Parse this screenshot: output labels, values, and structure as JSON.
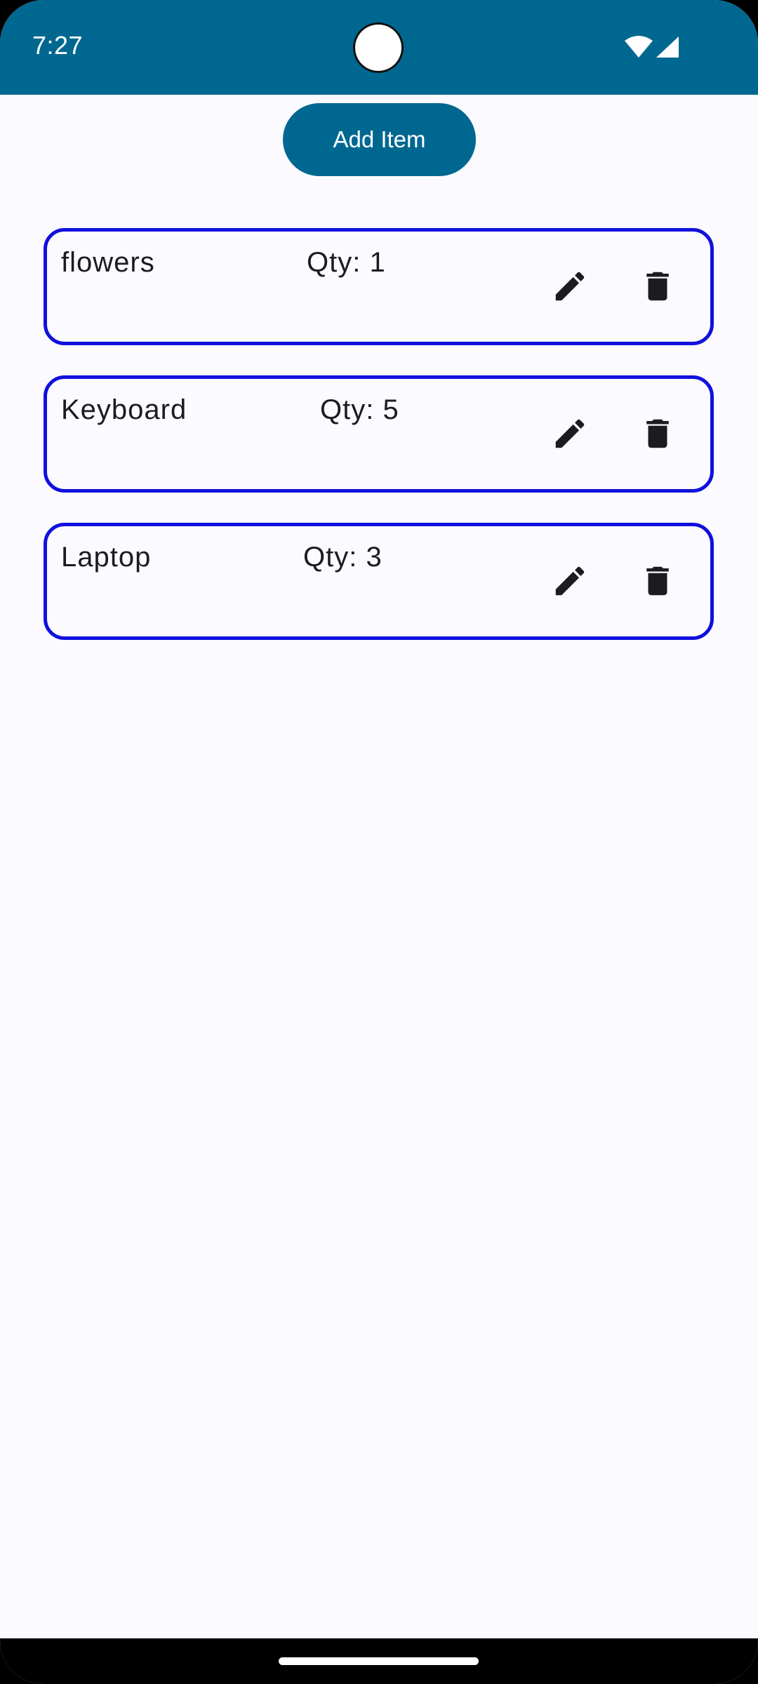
{
  "status_bar": {
    "time": "7:27",
    "background_color": "#006890",
    "icons": [
      "wifi-icon",
      "signal-icon"
    ]
  },
  "toolbar": {
    "add_label": "Add Item"
  },
  "items": [
    {
      "name": "flowers",
      "qty": "Qty: 1"
    },
    {
      "name": "Keyboard",
      "qty": "Qty: 5"
    },
    {
      "name": "Laptop",
      "qty": "Qty: 3"
    }
  ],
  "colors": {
    "accent": "#006890",
    "card_border": "#1010dd",
    "background": "#fafaff",
    "text": "#1d1b20"
  },
  "icons": {
    "edit": "pencil-icon",
    "delete": "trash-icon"
  }
}
